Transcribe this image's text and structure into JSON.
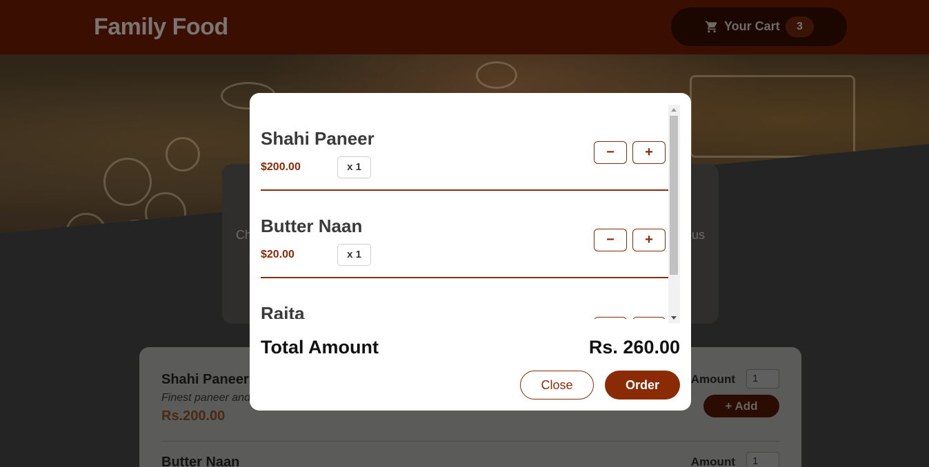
{
  "header": {
    "brand": "Family Food",
    "cart_label": "Your Cart",
    "cart_count": "3"
  },
  "summary": {
    "text_left": "Ch",
    "text_right": "ous"
  },
  "meals": [
    {
      "name": "Shahi Paneer",
      "description": "Finest paneer and",
      "price": "Rs.200.00",
      "amount_label": "Amount",
      "amount_value": "1",
      "add_label": "+ Add"
    },
    {
      "name": "Butter Naan",
      "amount_label": "Amount",
      "amount_value": "1"
    }
  ],
  "modal": {
    "items": [
      {
        "name": "Shahi Paneer",
        "price": "$200.00",
        "qty": "x 1",
        "minus": "−",
        "plus": "+"
      },
      {
        "name": "Butter Naan",
        "price": "$20.00",
        "qty": "x 1",
        "minus": "−",
        "plus": "+"
      },
      {
        "name": "Raita"
      }
    ],
    "total_label": "Total Amount",
    "total_value": "Rs. 260.00",
    "close_label": "Close",
    "order_label": "Order"
  },
  "colors": {
    "accent": "#8a2b06",
    "header_bg": "#3a0e00",
    "page_bg": "#242424"
  }
}
